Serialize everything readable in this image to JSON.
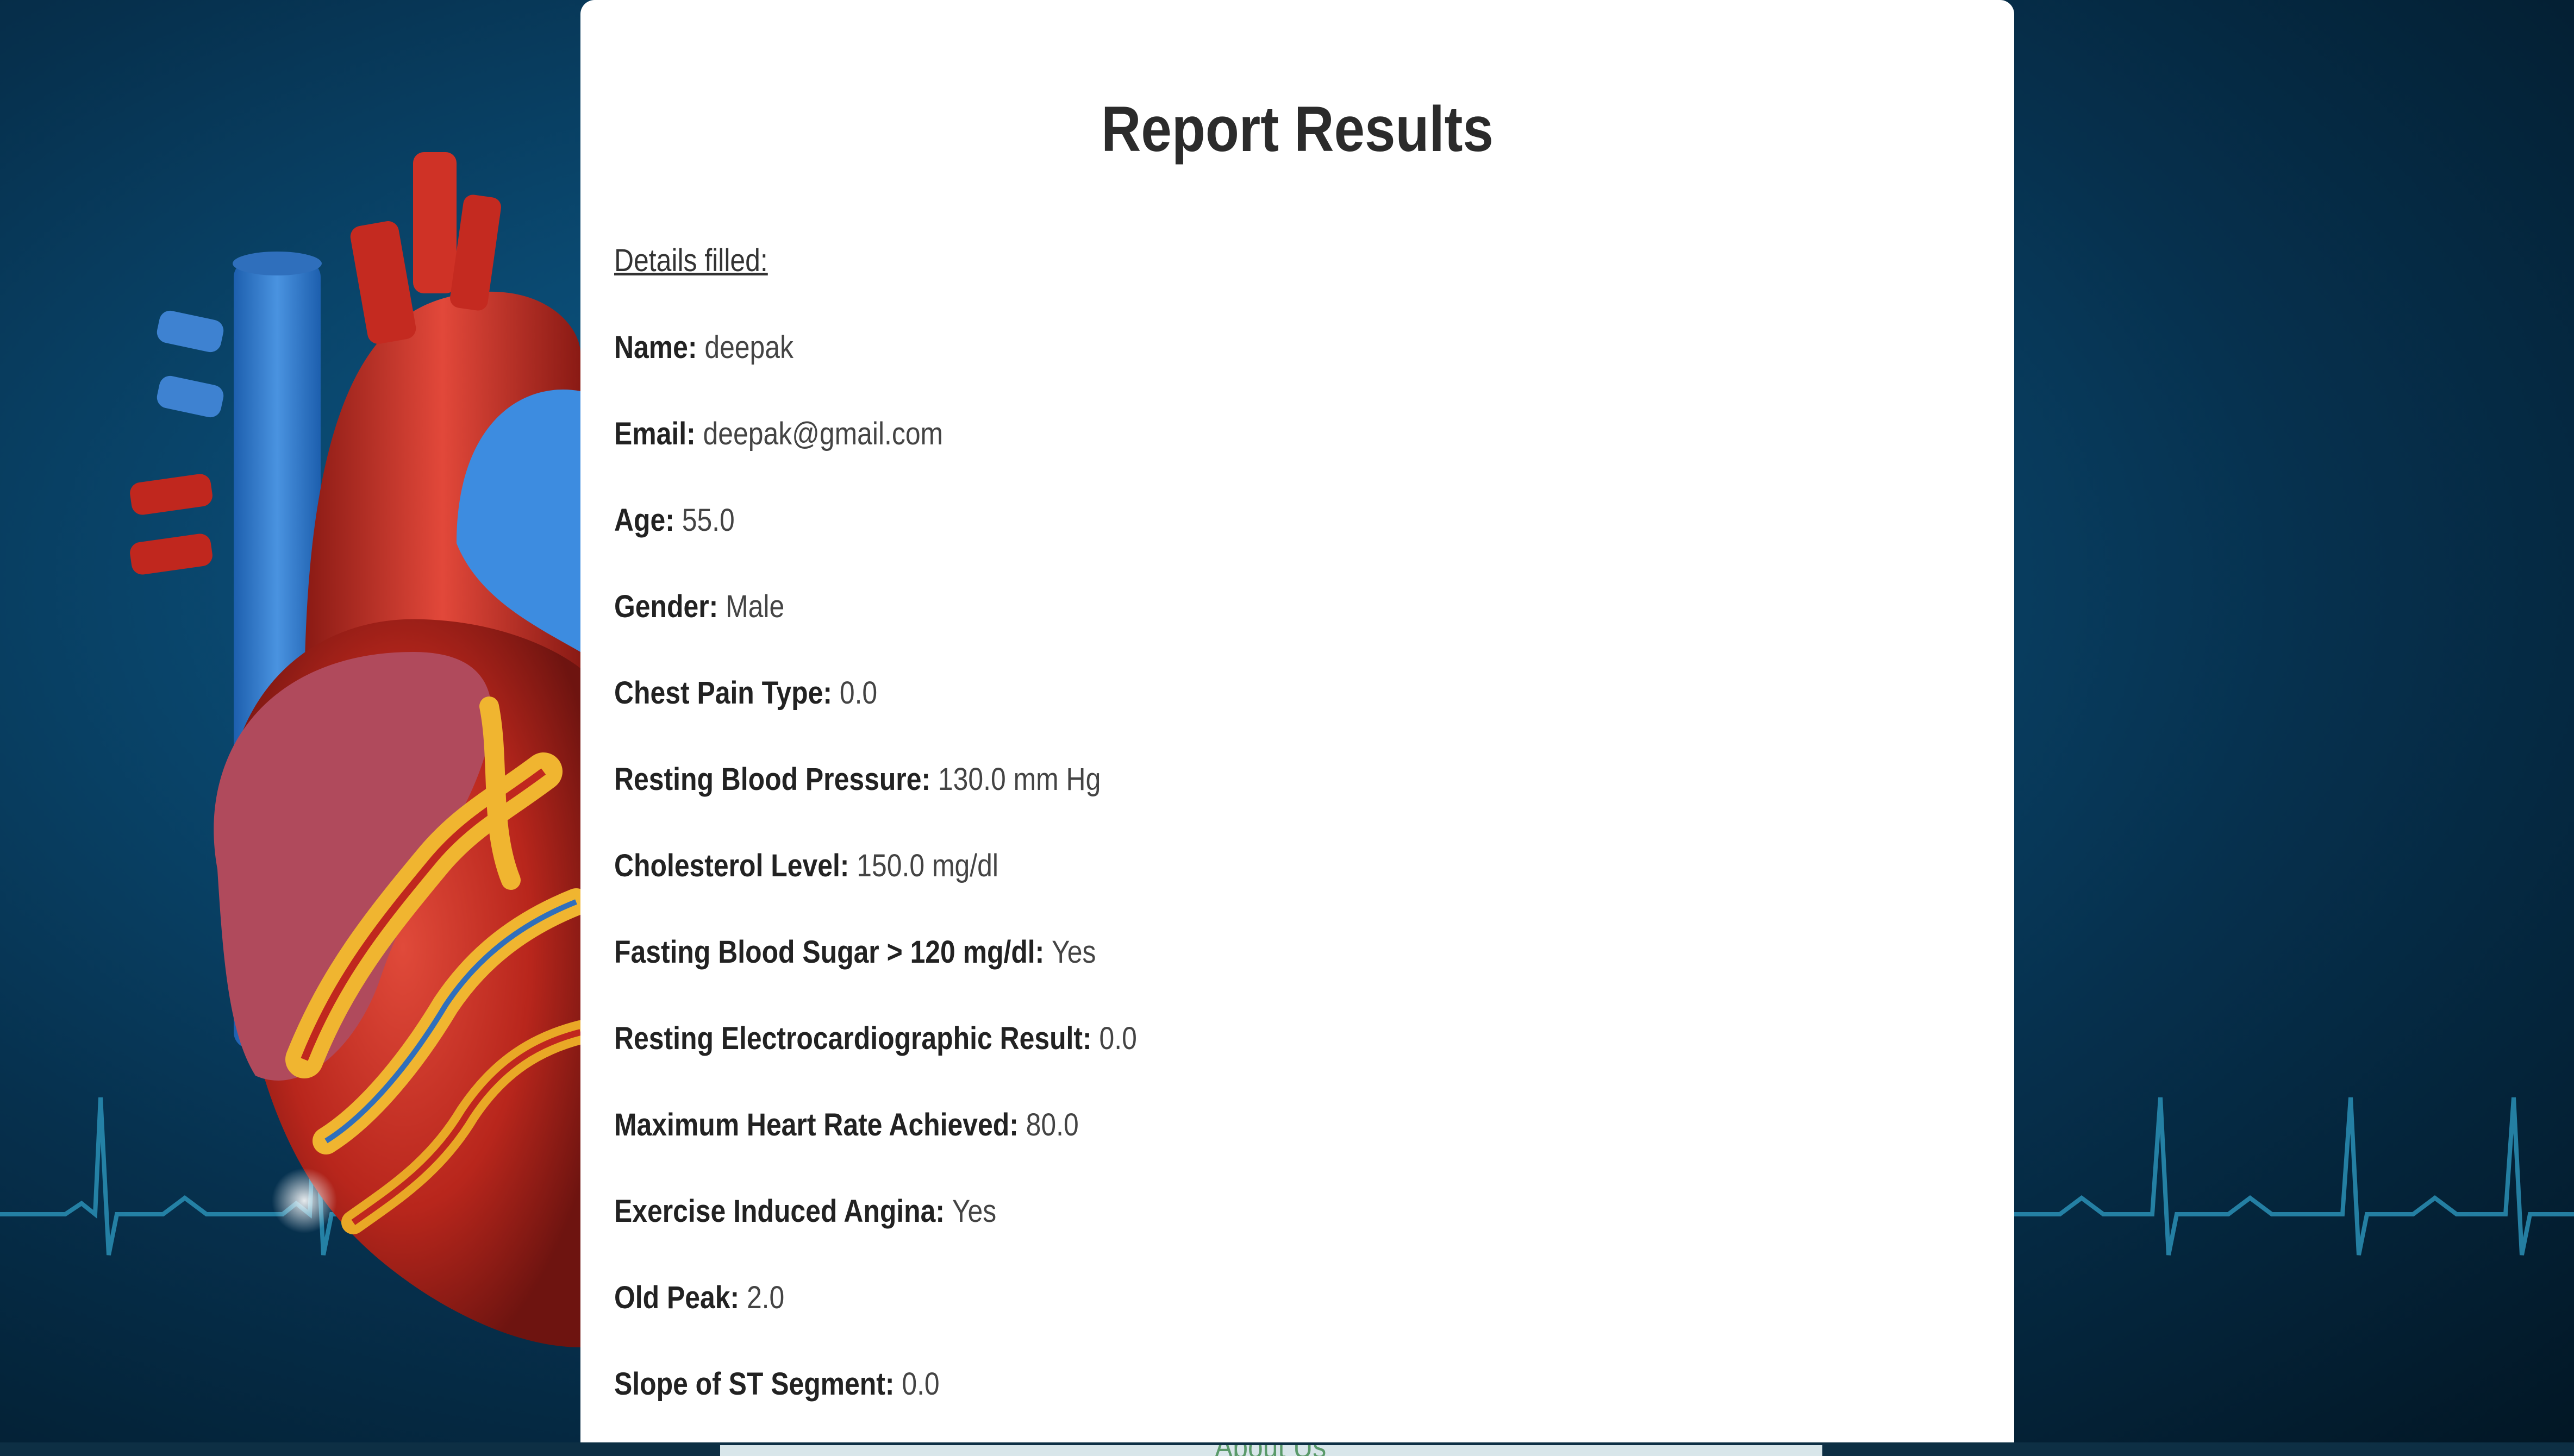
{
  "report": {
    "title": "Report Results",
    "subheading": "Details filled:",
    "fields": [
      {
        "label": "Name:",
        "value": "deepak"
      },
      {
        "label": "Email:",
        "value": "deepak@gmail.com"
      },
      {
        "label": "Age:",
        "value": "55.0"
      },
      {
        "label": "Gender:",
        "value": "Male"
      },
      {
        "label": "Chest Pain Type:",
        "value": "0.0"
      },
      {
        "label": "Resting Blood Pressure:",
        "value": "130.0 mm Hg"
      },
      {
        "label": "Cholesterol Level:",
        "value": "150.0 mg/dl"
      },
      {
        "label": "Fasting Blood Sugar > 120 mg/dl:",
        "value": "Yes"
      },
      {
        "label": "Resting Electrocardiographic Result:",
        "value": "0.0"
      },
      {
        "label": "Maximum Heart Rate Achieved:",
        "value": "80.0"
      },
      {
        "label": "Exercise Induced Angina:",
        "value": "Yes"
      },
      {
        "label": "Old Peak:",
        "value": "2.0"
      },
      {
        "label": "Slope of ST Segment:",
        "value": "0.0"
      }
    ]
  },
  "footer": {
    "link_label": "About Us"
  },
  "colors": {
    "background": "#0a4a72",
    "card": "#ffffff",
    "ecg_line": "#2a8fb5",
    "footer_link": "#5a9a6a"
  }
}
